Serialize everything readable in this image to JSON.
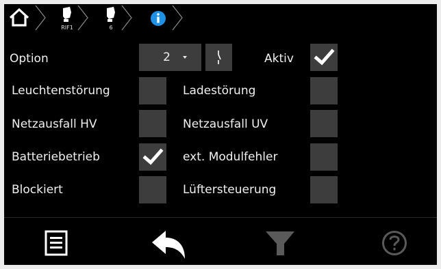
{
  "breadcrumb": {
    "items": [
      {
        "icon": "home-icon"
      },
      {
        "icon": "module-icon",
        "label": "RIF1"
      },
      {
        "icon": "module-icon",
        "label": "6"
      },
      {
        "icon": "info-icon",
        "color": "#1e90e6"
      }
    ]
  },
  "option": {
    "label": "Option",
    "value": "2",
    "active_label": "Aktiv",
    "active_checked": true
  },
  "checks": [
    {
      "label": "Leuchtenstörung",
      "checked": false
    },
    {
      "label": "Ladestörung",
      "checked": false
    },
    {
      "label": "Netzausfall HV",
      "checked": false
    },
    {
      "label": "Netzausfall UV",
      "checked": false
    },
    {
      "label": "Batteriebetrieb",
      "checked": true
    },
    {
      "label": "ext. Modulfehler",
      "checked": false
    },
    {
      "label": "Blockiert",
      "checked": false
    },
    {
      "label": "Lüftersteuerung",
      "checked": false
    }
  ],
  "footer": {
    "buttons": [
      {
        "icon": "menu-icon",
        "enabled": true
      },
      {
        "icon": "back-arrow-icon",
        "enabled": true
      },
      {
        "icon": "filter-icon",
        "enabled": false
      },
      {
        "icon": "help-icon",
        "enabled": false
      }
    ]
  },
  "colors": {
    "background": "#000000",
    "control": "#3d3d3d",
    "text": "#f0f0f0",
    "accent": "#1e90e6",
    "disabled": "#5a5a5a"
  }
}
